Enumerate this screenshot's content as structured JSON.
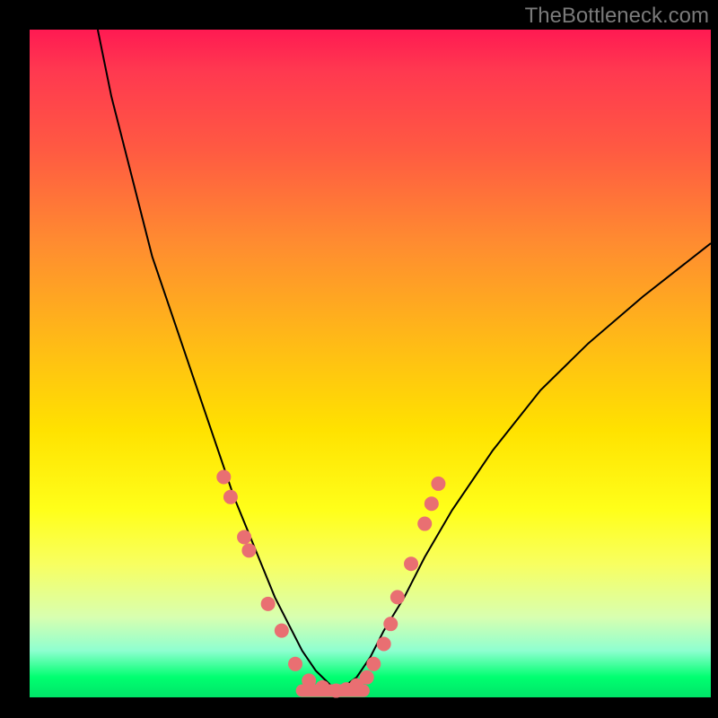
{
  "watermark": "TheBottleneck.com",
  "chart_data": {
    "type": "line",
    "title": "",
    "xlabel": "",
    "ylabel": "",
    "xlim": [
      0,
      100
    ],
    "ylim": [
      0,
      100
    ],
    "curve_left": {
      "x": [
        10,
        12,
        15,
        18,
        22,
        26,
        30,
        34,
        36,
        38,
        40,
        42,
        44,
        45
      ],
      "y": [
        100,
        90,
        78,
        66,
        54,
        42,
        30,
        20,
        15,
        11,
        7,
        4,
        2,
        1
      ]
    },
    "curve_right": {
      "x": [
        45,
        46,
        48,
        50,
        52,
        55,
        58,
        62,
        68,
        75,
        82,
        90,
        100
      ],
      "y": [
        1,
        1.5,
        3,
        6,
        10,
        15,
        21,
        28,
        37,
        46,
        53,
        60,
        68
      ]
    },
    "flat_zone": {
      "x": [
        40,
        49
      ],
      "y": 1
    },
    "dots_left": [
      {
        "x": 28.5,
        "y": 33
      },
      {
        "x": 29.5,
        "y": 30
      },
      {
        "x": 31.5,
        "y": 24
      },
      {
        "x": 32.2,
        "y": 22
      },
      {
        "x": 35.0,
        "y": 14
      },
      {
        "x": 37.0,
        "y": 10
      },
      {
        "x": 39.0,
        "y": 5
      },
      {
        "x": 41.0,
        "y": 2.5
      },
      {
        "x": 43.0,
        "y": 1.5
      },
      {
        "x": 45.0,
        "y": 1
      }
    ],
    "dots_right": [
      {
        "x": 46.5,
        "y": 1.2
      },
      {
        "x": 48.0,
        "y": 1.8
      },
      {
        "x": 49.5,
        "y": 3
      },
      {
        "x": 50.5,
        "y": 5
      },
      {
        "x": 52.0,
        "y": 8
      },
      {
        "x": 53.0,
        "y": 11
      },
      {
        "x": 54.0,
        "y": 15
      },
      {
        "x": 56.0,
        "y": 20
      },
      {
        "x": 58.0,
        "y": 26
      },
      {
        "x": 59.0,
        "y": 29
      },
      {
        "x": 60.0,
        "y": 32
      }
    ],
    "colors": {
      "curve": "#000000",
      "dots": "#e96f72",
      "flat": "#e96f72"
    }
  }
}
